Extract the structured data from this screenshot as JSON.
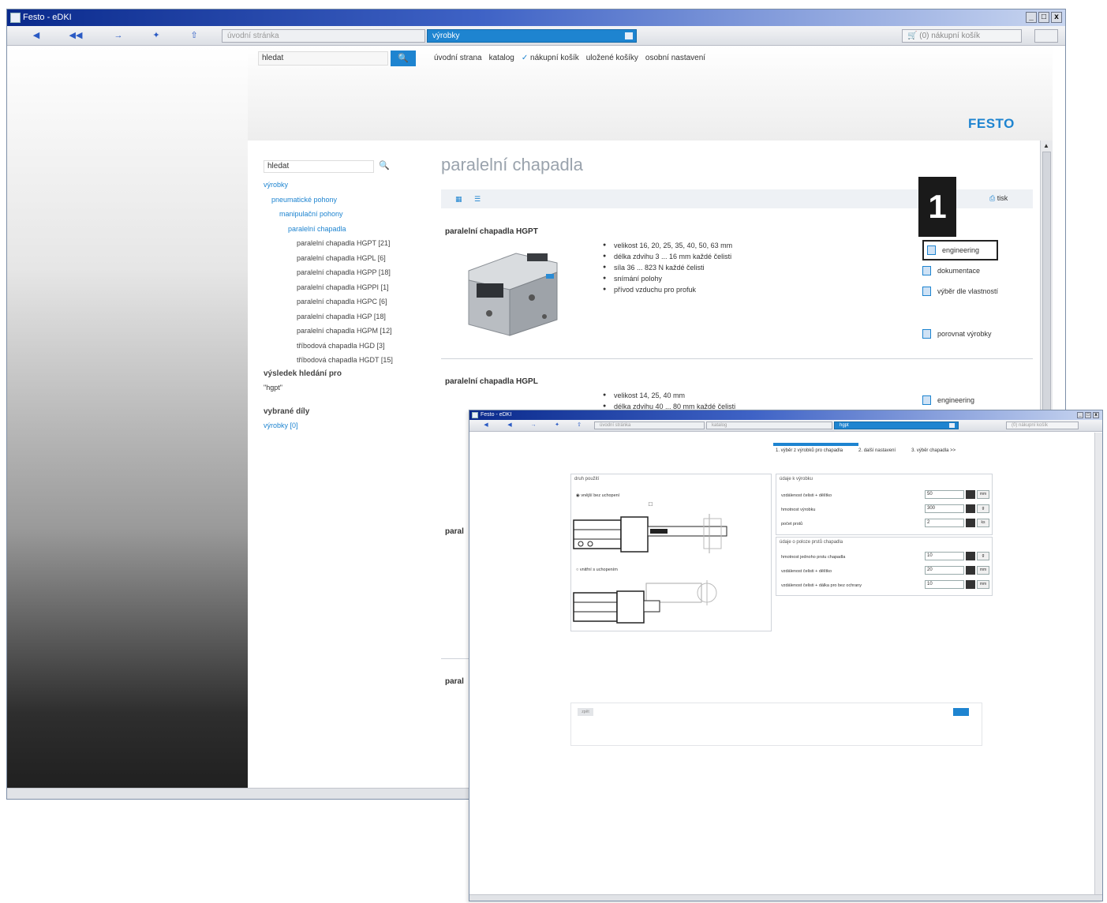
{
  "window1": {
    "title": "Festo - eDKI",
    "controls": [
      "_",
      "□",
      "x"
    ],
    "address": "úvodní stránka",
    "tab_address": "výrobky",
    "cart_label": "(0) nákupní košík",
    "search_placeholder": "hledat",
    "search_button": "🔍",
    "top_nav": [
      "úvodní strana",
      "katalog",
      "nákupní košík",
      "uložené košíky",
      "osobní nastavení"
    ],
    "brand": "FESTO"
  },
  "sidebar": {
    "search_value": "hledat",
    "tree": [
      {
        "level": 0,
        "label": "výrobky"
      },
      {
        "level": 1,
        "label": "pneumatické pohony"
      },
      {
        "level": 2,
        "label": "manipulační pohony"
      },
      {
        "level": 3,
        "label": "paralelní chapadla"
      },
      {
        "level": 4,
        "label": "paralelní chapadla HGPT [21]"
      },
      {
        "level": 4,
        "label": "paralelní chapadla HGPL [6]"
      },
      {
        "level": 4,
        "label": "paralelní chapadla HGPP [18]"
      },
      {
        "level": 4,
        "label": "paralelní chapadla HGPPI [1]"
      },
      {
        "level": 4,
        "label": "paralelní chapadla HGPC [6]"
      },
      {
        "level": 4,
        "label": "paralelní chapadla HGP [18]"
      },
      {
        "level": 4,
        "label": "paralelní chapadla HGPM [12]"
      },
      {
        "level": 4,
        "label": "tříbodová chapadla HGD [3]"
      },
      {
        "level": 4,
        "label": "tříbodová chapadla HGDT [15]"
      }
    ],
    "result_heading": "výsledek hledání pro",
    "result_query": "\"hgpt\"",
    "selected_heading": "vybrané díly",
    "selected_link": "výrobky [0]"
  },
  "main": {
    "page_title": "paralelní chapadla",
    "print_label": "tisk",
    "callout_number": "1",
    "products": [
      {
        "name": "paralelní chapadla HGPT",
        "bullets": [
          "velikost 16, 20, 25, 35, 40, 50, 63 mm",
          "délka zdvihu 3 ... 16 mm každé čelisti",
          "síla 36 ... 823 N každé čelisti",
          "snímání polohy",
          "přívod vzduchu pro profuk"
        ],
        "links": [
          "engineering",
          "dokumentace",
          "výběr dle vlastností",
          "porovnat výrobky"
        ]
      },
      {
        "name": "paralelní chapadla HGPL",
        "bullets": [
          "velikost 14, 25, 40 mm",
          "délka zdvihu 40 ... 80 mm každé čelisti"
        ],
        "links": [
          "engineering"
        ]
      },
      {
        "name": "paral",
        "bullets": [],
        "links": []
      },
      {
        "name": "paral",
        "bullets": [],
        "links": []
      }
    ]
  },
  "window2": {
    "title": "Festo - eDKI",
    "address": "úvodní stránka",
    "tab_address": "katalog",
    "address_active": "hgpt",
    "cart_label": "(0) nákupní košík",
    "steps": [
      "1. výběr z výrobků pro chapadla",
      "2. další nastavení",
      "3. výběr chapadla >>"
    ],
    "left_panel": {
      "title": "druh použití",
      "option1": "vnější bez uchopení",
      "option2": "vnitřní s uchopením"
    },
    "right_panel1": {
      "title": "údaje k výrobku",
      "rows": [
        {
          "label": "vzdálenost čelisti + dělítko",
          "value": "50",
          "unit": "mm"
        },
        {
          "label": "hmotnost výrobku",
          "value": "300",
          "unit": "g"
        },
        {
          "label": "počet prstů",
          "value": "2",
          "unit": "ks"
        }
      ]
    },
    "right_panel2": {
      "title": "údaje o poloze prstů chapadla",
      "rows": [
        {
          "label": "hmotnost jednoho prstu chapadla",
          "value": "10",
          "unit": "g"
        },
        {
          "label": "vzdálenost čelisti + dělítko",
          "value": "20",
          "unit": "mm"
        },
        {
          "label": "vzdálenost čelisti + dálka pro bez ochrany",
          "value": "10",
          "unit": "mm"
        }
      ]
    },
    "bottom_label": "zpět"
  },
  "colors": {
    "accent": "#1e84d0",
    "callout": "#1a1a1a",
    "title_gray": "#9aa3ad"
  }
}
